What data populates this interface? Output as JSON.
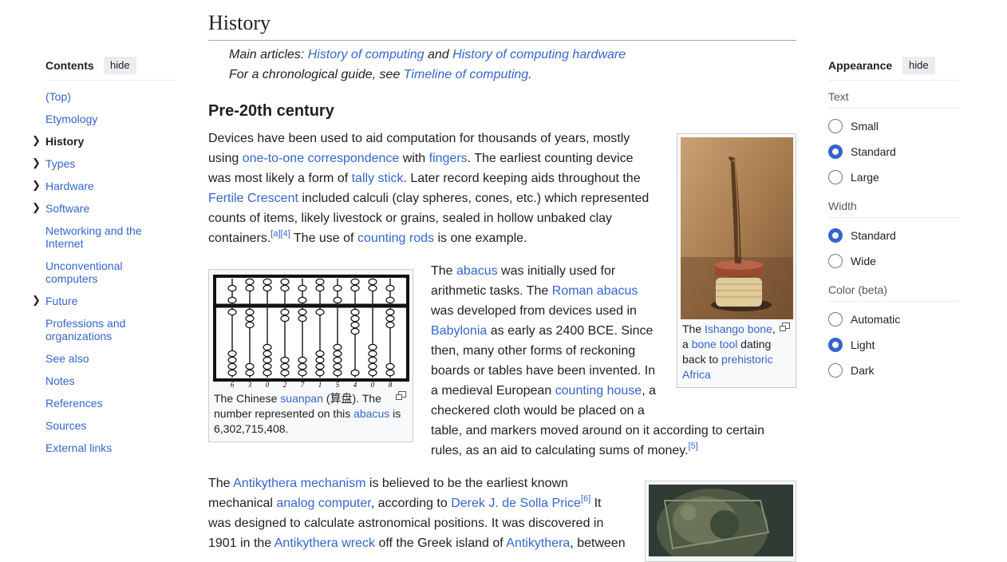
{
  "toc": {
    "title": "Contents",
    "hide": "hide",
    "items": [
      "(Top)",
      "Etymology",
      "History",
      "Types",
      "Hardware",
      "Software",
      "Networking and the Internet",
      "Unconventional computers",
      "Future",
      "Professions and organizations",
      "See also",
      "Notes",
      "References",
      "Sources",
      "External links"
    ]
  },
  "article": {
    "heading": "History",
    "hatnote1": {
      "prefix": "Main articles: ",
      "link1": "History of computing",
      "mid": " and ",
      "link2": "History of computing hardware"
    },
    "hatnote2": {
      "prefix": "For a chronological guide, see ",
      "link": "Timeline of computing",
      "suffix": "."
    },
    "subheading": "Pre-20th century",
    "p1": {
      "t1": "Devices have been used to aid computation for thousands of years, mostly",
      "t2": "using ",
      "l1": "one-to-one correspondence",
      "t3": " with ",
      "l2": "fingers",
      "t4": ". The earliest counting device",
      "t5": "was most likely a form of ",
      "l3": "tally stick",
      "t6": ". Later record keeping aids throughout the",
      "l4": "Fertile Crescent",
      "t7": " included calculi (clay spheres, cones, etc.) which represented",
      "t8": "counts of items, likely livestock or grains, sealed in hollow unbaked clay",
      "t9": "containers.",
      "ref1": "[a]",
      "ref2": "[4]",
      "t10": " The use of ",
      "l5": "counting rods",
      "t11": " is one example."
    },
    "p2": {
      "t1": "The ",
      "l1": "abacus",
      "t2": " was initially used for",
      "t3": "arithmetic tasks. The ",
      "l2": "Roman abacus",
      "t4": "was developed from devices used in",
      "l3": "Babylonia",
      "t5": " as early as 2400 BCE. Since",
      "t6": "then, many other forms of reckoning",
      "t7": "boards or tables have been invented. In",
      "t8": "a medieval European ",
      "l4": "counting house",
      "t9": ", a",
      "t10": "checkered cloth would be placed on a",
      "t11": "table, and markers moved around on it according to certain",
      "t12": "rules, as an aid to calculating sums of money.",
      "ref": "[5]"
    },
    "p3": {
      "t1": "The ",
      "l1": "Antikythera mechanism",
      "t2": " is believed to be the earliest known",
      "t3": "mechanical ",
      "l2": "analog computer",
      "t4": ", according to ",
      "l3": "Derek J. de Solla Price",
      "ref": "[6]",
      "t5": " It",
      "t6": "was designed to calculate astronomical positions. It was discovered in",
      "t7": "1901 in the ",
      "l4": "Antikythera wreck",
      "t8": " off the Greek island of ",
      "l5": "Antikythera",
      "t9": ", between"
    },
    "fig_abacus": {
      "digits": [
        "6",
        "3",
        "0",
        "2",
        "7",
        "1",
        "5",
        "4",
        "0",
        "8"
      ],
      "c1": "The Chinese ",
      "l1": "suanpan",
      "c2": " (算盘). The",
      "c3": "number represented on this ",
      "l2": "abacus",
      "c4": " is",
      "c5": "6,302,715,408."
    },
    "fig_bone": {
      "c1": "The ",
      "l1": "Ishango bone",
      "c2": ",",
      "c3": "a ",
      "l2": "bone tool",
      "c4": " dating",
      "c5": "back to ",
      "l3": "prehistoric",
      "l4": "Africa"
    }
  },
  "appearance": {
    "title": "Appearance",
    "hide": "hide",
    "text_label": "Text",
    "text_options": [
      "Small",
      "Standard",
      "Large"
    ],
    "width_label": "Width",
    "width_options": [
      "Standard",
      "Wide"
    ],
    "color_label": "Color (beta)",
    "color_options": [
      "Automatic",
      "Light",
      "Dark"
    ]
  },
  "colors": {
    "link": "#3366cc",
    "text": "#202122",
    "accent": "#3366cc"
  }
}
